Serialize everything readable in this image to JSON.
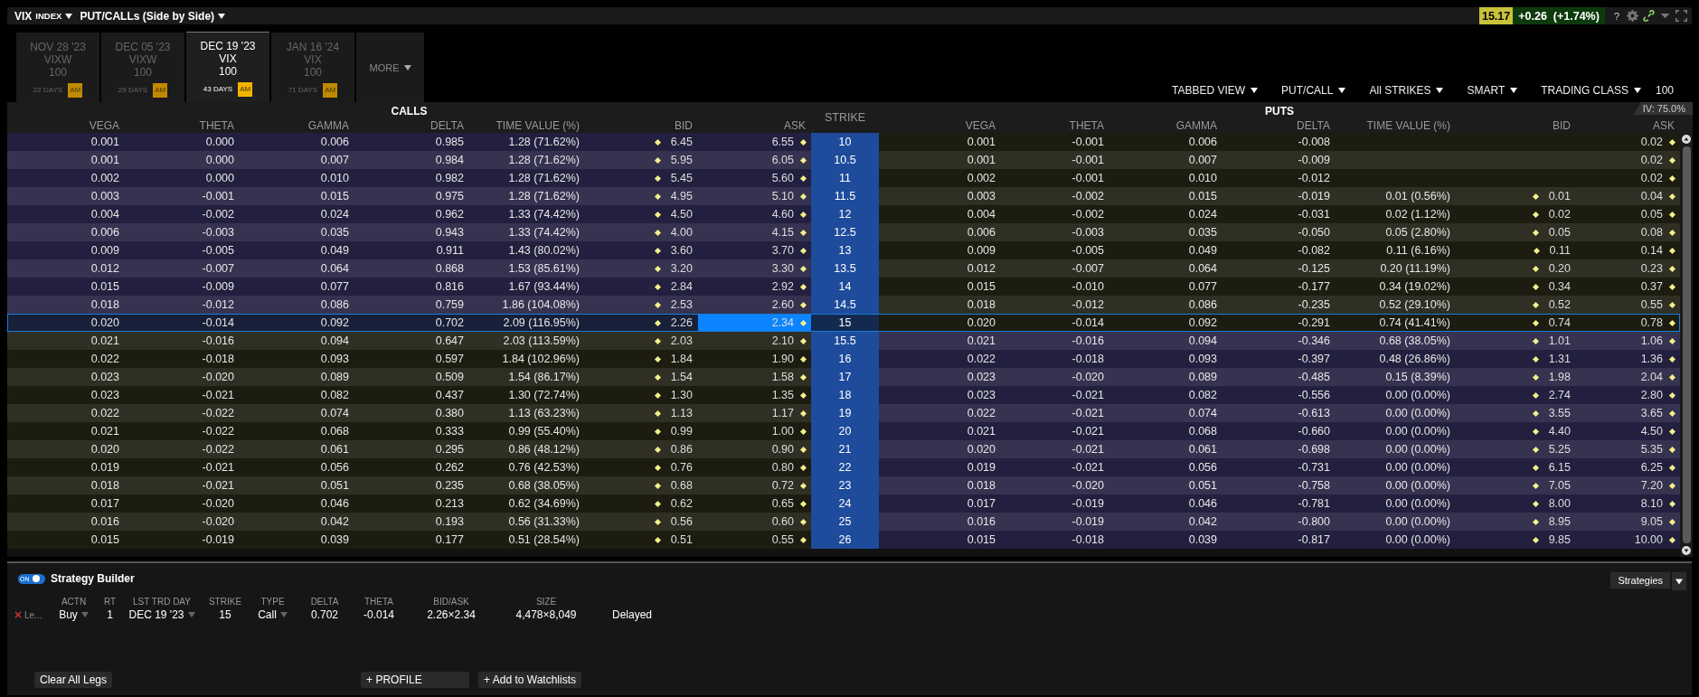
{
  "header": {
    "symbol": "VIX",
    "symbol_type": "INDEX",
    "view": "PUT/CALLs (Side by Side)",
    "price": "15.17",
    "change": "+0.26  (+1.74%)",
    "help": "?"
  },
  "expiry_tabs": [
    {
      "date": "NOV 28 '23",
      "class": "VIXW",
      "multiplier": "100",
      "days": "22 DAYS",
      "session": "AM",
      "selected": false
    },
    {
      "date": "DEC 05 '23",
      "class": "VIXW",
      "multiplier": "100",
      "days": "29 DAYS",
      "session": "AM",
      "selected": false
    },
    {
      "date": "DEC 19 '23",
      "class": "VIX",
      "multiplier": "100",
      "days": "43 DAYS",
      "session": "AM",
      "selected": true
    },
    {
      "date": "JAN 16 '24",
      "class": "VIX",
      "multiplier": "100",
      "days": "71 DAYS",
      "session": "AM",
      "selected": false
    }
  ],
  "more_tab": {
    "label": "MORE"
  },
  "toolbar": [
    {
      "label": "TABBED VIEW"
    },
    {
      "label": "PUT/CALL"
    },
    {
      "label": "All STRIKES"
    },
    {
      "label": "SMART"
    },
    {
      "label": "TRADING CLASS"
    }
  ],
  "trading_class_value": "100",
  "chain": {
    "calls_title": "CALLS",
    "puts_title": "PUTS",
    "strike_header": "STRIKE",
    "iv": "IV: 75.0%",
    "call_columns": [
      "VEGA",
      "THETA",
      "GAMMA",
      "DELTA",
      "TIME VALUE (%)",
      "BID",
      "ASK"
    ],
    "put_columns": [
      "VEGA",
      "THETA",
      "GAMMA",
      "DELTA",
      "TIME VALUE (%)",
      "BID",
      "ASK"
    ],
    "rows": [
      {
        "strike": "10",
        "calls_itm": true,
        "selected": false,
        "calls": {
          "vega": "0.001",
          "theta": "0.000",
          "gamma": "0.006",
          "delta": "0.985",
          "time_value": "1.28 (71.62%)",
          "bid": "6.45",
          "ask": "6.55"
        },
        "puts": {
          "vega": "0.001",
          "theta": "-0.001",
          "gamma": "0.006",
          "delta": "-0.008",
          "ask": "0.02"
        }
      },
      {
        "strike": "10.5",
        "calls_itm": true,
        "selected": false,
        "calls": {
          "vega": "0.001",
          "theta": "0.000",
          "gamma": "0.007",
          "delta": "0.984",
          "time_value": "1.28 (71.62%)",
          "bid": "5.95",
          "ask": "6.05"
        },
        "puts": {
          "vega": "0.001",
          "theta": "-0.001",
          "gamma": "0.007",
          "delta": "-0.009",
          "ask": "0.02"
        }
      },
      {
        "strike": "11",
        "calls_itm": true,
        "selected": false,
        "calls": {
          "vega": "0.002",
          "theta": "0.000",
          "gamma": "0.010",
          "delta": "0.982",
          "time_value": "1.28 (71.62%)",
          "bid": "5.45",
          "ask": "5.60"
        },
        "puts": {
          "vega": "0.002",
          "theta": "-0.001",
          "gamma": "0.010",
          "delta": "-0.012",
          "ask": "0.02"
        }
      },
      {
        "strike": "11.5",
        "calls_itm": true,
        "selected": false,
        "calls": {
          "vega": "0.003",
          "theta": "-0.001",
          "gamma": "0.015",
          "delta": "0.975",
          "time_value": "1.28 (71.62%)",
          "bid": "4.95",
          "ask": "5.10"
        },
        "puts": {
          "vega": "0.003",
          "theta": "-0.002",
          "gamma": "0.015",
          "delta": "-0.019",
          "time_value": "0.01 (0.56%)",
          "bid": "0.01",
          "ask": "0.04"
        }
      },
      {
        "strike": "12",
        "calls_itm": true,
        "selected": false,
        "calls": {
          "vega": "0.004",
          "theta": "-0.002",
          "gamma": "0.024",
          "delta": "0.962",
          "time_value": "1.33 (74.42%)",
          "bid": "4.50",
          "ask": "4.60"
        },
        "puts": {
          "vega": "0.004",
          "theta": "-0.002",
          "gamma": "0.024",
          "delta": "-0.031",
          "time_value": "0.02 (1.12%)",
          "bid": "0.02",
          "ask": "0.05"
        }
      },
      {
        "strike": "12.5",
        "calls_itm": true,
        "selected": false,
        "calls": {
          "vega": "0.006",
          "theta": "-0.003",
          "gamma": "0.035",
          "delta": "0.943",
          "time_value": "1.33 (74.42%)",
          "bid": "4.00",
          "ask": "4.15"
        },
        "puts": {
          "vega": "0.006",
          "theta": "-0.003",
          "gamma": "0.035",
          "delta": "-0.050",
          "time_value": "0.05 (2.80%)",
          "bid": "0.05",
          "ask": "0.08"
        }
      },
      {
        "strike": "13",
        "calls_itm": true,
        "selected": false,
        "calls": {
          "vega": "0.009",
          "theta": "-0.005",
          "gamma": "0.049",
          "delta": "0.911",
          "time_value": "1.43 (80.02%)",
          "bid": "3.60",
          "ask": "3.70"
        },
        "puts": {
          "vega": "0.009",
          "theta": "-0.005",
          "gamma": "0.049",
          "delta": "-0.082",
          "time_value": "0.11 (6.16%)",
          "bid": "0.11",
          "ask": "0.14"
        }
      },
      {
        "strike": "13.5",
        "calls_itm": true,
        "selected": false,
        "calls": {
          "vega": "0.012",
          "theta": "-0.007",
          "gamma": "0.064",
          "delta": "0.868",
          "time_value": "1.53 (85.61%)",
          "bid": "3.20",
          "ask": "3.30"
        },
        "puts": {
          "vega": "0.012",
          "theta": "-0.007",
          "gamma": "0.064",
          "delta": "-0.125",
          "time_value": "0.20 (11.19%)",
          "bid": "0.20",
          "ask": "0.23"
        }
      },
      {
        "strike": "14",
        "calls_itm": true,
        "selected": false,
        "calls": {
          "vega": "0.015",
          "theta": "-0.009",
          "gamma": "0.077",
          "delta": "0.816",
          "time_value": "1.67 (93.44%)",
          "bid": "2.84",
          "ask": "2.92"
        },
        "puts": {
          "vega": "0.015",
          "theta": "-0.010",
          "gamma": "0.077",
          "delta": "-0.177",
          "time_value": "0.34 (19.02%)",
          "bid": "0.34",
          "ask": "0.37"
        }
      },
      {
        "strike": "14.5",
        "calls_itm": true,
        "selected": false,
        "calls": {
          "vega": "0.018",
          "theta": "-0.012",
          "gamma": "0.086",
          "delta": "0.759",
          "time_value": "1.86 (104.08%)",
          "bid": "2.53",
          "ask": "2.60"
        },
        "puts": {
          "vega": "0.018",
          "theta": "-0.012",
          "gamma": "0.086",
          "delta": "-0.235",
          "time_value": "0.52 (29.10%)",
          "bid": "0.52",
          "ask": "0.55"
        }
      },
      {
        "strike": "15",
        "calls_itm": true,
        "selected": true,
        "calls": {
          "vega": "0.020",
          "theta": "-0.014",
          "gamma": "0.092",
          "delta": "0.702",
          "time_value": "2.09 (116.95%)",
          "bid": "2.26",
          "ask": "2.34"
        },
        "puts": {
          "vega": "0.020",
          "theta": "-0.014",
          "gamma": "0.092",
          "delta": "-0.291",
          "time_value": "0.74 (41.41%)",
          "bid": "0.74",
          "ask": "0.78"
        }
      },
      {
        "strike": "15.5",
        "calls_itm": false,
        "selected": false,
        "calls": {
          "vega": "0.021",
          "theta": "-0.016",
          "gamma": "0.094",
          "delta": "0.647",
          "time_value": "2.03 (113.59%)",
          "bid": "2.03",
          "ask": "2.10"
        },
        "puts": {
          "vega": "0.021",
          "theta": "-0.016",
          "gamma": "0.094",
          "delta": "-0.346",
          "time_value": "0.68 (38.05%)",
          "bid": "1.01",
          "ask": "1.06"
        }
      },
      {
        "strike": "16",
        "calls_itm": false,
        "selected": false,
        "calls": {
          "vega": "0.022",
          "theta": "-0.018",
          "gamma": "0.093",
          "delta": "0.597",
          "time_value": "1.84 (102.96%)",
          "bid": "1.84",
          "ask": "1.90"
        },
        "puts": {
          "vega": "0.022",
          "theta": "-0.018",
          "gamma": "0.093",
          "delta": "-0.397",
          "time_value": "0.48 (26.86%)",
          "bid": "1.31",
          "ask": "1.36"
        }
      },
      {
        "strike": "17",
        "calls_itm": false,
        "selected": false,
        "calls": {
          "vega": "0.023",
          "theta": "-0.020",
          "gamma": "0.089",
          "delta": "0.509",
          "time_value": "1.54 (86.17%)",
          "bid": "1.54",
          "ask": "1.58"
        },
        "puts": {
          "vega": "0.023",
          "theta": "-0.020",
          "gamma": "0.089",
          "delta": "-0.485",
          "time_value": "0.15 (8.39%)",
          "bid": "1.98",
          "ask": "2.04"
        }
      },
      {
        "strike": "18",
        "calls_itm": false,
        "selected": false,
        "calls": {
          "vega": "0.023",
          "theta": "-0.021",
          "gamma": "0.082",
          "delta": "0.437",
          "time_value": "1.30 (72.74%)",
          "bid": "1.30",
          "ask": "1.35"
        },
        "puts": {
          "vega": "0.023",
          "theta": "-0.021",
          "gamma": "0.082",
          "delta": "-0.556",
          "time_value": "0.00 (0.00%)",
          "bid": "2.74",
          "ask": "2.80"
        }
      },
      {
        "strike": "19",
        "calls_itm": false,
        "selected": false,
        "calls": {
          "vega": "0.022",
          "theta": "-0.022",
          "gamma": "0.074",
          "delta": "0.380",
          "time_value": "1.13 (63.23%)",
          "bid": "1.13",
          "ask": "1.17"
        },
        "puts": {
          "vega": "0.022",
          "theta": "-0.021",
          "gamma": "0.074",
          "delta": "-0.613",
          "time_value": "0.00 (0.00%)",
          "bid": "3.55",
          "ask": "3.65"
        }
      },
      {
        "strike": "20",
        "calls_itm": false,
        "selected": false,
        "calls": {
          "vega": "0.021",
          "theta": "-0.022",
          "gamma": "0.068",
          "delta": "0.333",
          "time_value": "0.99 (55.40%)",
          "bid": "0.99",
          "ask": "1.00"
        },
        "puts": {
          "vega": "0.021",
          "theta": "-0.021",
          "gamma": "0.068",
          "delta": "-0.660",
          "time_value": "0.00 (0.00%)",
          "bid": "4.40",
          "ask": "4.50"
        }
      },
      {
        "strike": "21",
        "calls_itm": false,
        "selected": false,
        "calls": {
          "vega": "0.020",
          "theta": "-0.022",
          "gamma": "0.061",
          "delta": "0.295",
          "time_value": "0.86 (48.12%)",
          "bid": "0.86",
          "ask": "0.90"
        },
        "puts": {
          "vega": "0.020",
          "theta": "-0.021",
          "gamma": "0.061",
          "delta": "-0.698",
          "time_value": "0.00 (0.00%)",
          "bid": "5.25",
          "ask": "5.35"
        }
      },
      {
        "strike": "22",
        "calls_itm": false,
        "selected": false,
        "calls": {
          "vega": "0.019",
          "theta": "-0.021",
          "gamma": "0.056",
          "delta": "0.262",
          "time_value": "0.76 (42.53%)",
          "bid": "0.76",
          "ask": "0.80"
        },
        "puts": {
          "vega": "0.019",
          "theta": "-0.021",
          "gamma": "0.056",
          "delta": "-0.731",
          "time_value": "0.00 (0.00%)",
          "bid": "6.15",
          "ask": "6.25"
        }
      },
      {
        "strike": "23",
        "calls_itm": false,
        "selected": false,
        "calls": {
          "vega": "0.018",
          "theta": "-0.021",
          "gamma": "0.051",
          "delta": "0.235",
          "time_value": "0.68 (38.05%)",
          "bid": "0.68",
          "ask": "0.72"
        },
        "puts": {
          "vega": "0.018",
          "theta": "-0.020",
          "gamma": "0.051",
          "delta": "-0.758",
          "time_value": "0.00 (0.00%)",
          "bid": "7.05",
          "ask": "7.20"
        }
      },
      {
        "strike": "24",
        "calls_itm": false,
        "selected": false,
        "calls": {
          "vega": "0.017",
          "theta": "-0.020",
          "gamma": "0.046",
          "delta": "0.213",
          "time_value": "0.62 (34.69%)",
          "bid": "0.62",
          "ask": "0.65"
        },
        "puts": {
          "vega": "0.017",
          "theta": "-0.019",
          "gamma": "0.046",
          "delta": "-0.781",
          "time_value": "0.00 (0.00%)",
          "bid": "8.00",
          "ask": "8.10"
        }
      },
      {
        "strike": "25",
        "calls_itm": false,
        "selected": false,
        "calls": {
          "vega": "0.016",
          "theta": "-0.020",
          "gamma": "0.042",
          "delta": "0.193",
          "time_value": "0.56 (31.33%)",
          "bid": "0.56",
          "ask": "0.60"
        },
        "puts": {
          "vega": "0.016",
          "theta": "-0.019",
          "gamma": "0.042",
          "delta": "-0.800",
          "time_value": "0.00 (0.00%)",
          "bid": "8.95",
          "ask": "9.05"
        }
      },
      {
        "strike": "26",
        "calls_itm": false,
        "selected": false,
        "calls": {
          "vega": "0.015",
          "theta": "-0.019",
          "gamma": "0.039",
          "delta": "0.177",
          "time_value": "0.51 (28.54%)",
          "bid": "0.51",
          "ask": "0.55"
        },
        "puts": {
          "vega": "0.015",
          "theta": "-0.018",
          "gamma": "0.039",
          "delta": "-0.817",
          "time_value": "0.00 (0.00%)",
          "bid": "9.85",
          "ask": "10.00"
        }
      }
    ]
  },
  "strategy_builder": {
    "on": true,
    "toggle_label": "ON",
    "title": "Strategy Builder",
    "strategies_button": "Strategies",
    "columns": [
      "ACTN",
      "RT",
      "LST TRD DAY",
      "STRIKE",
      "TYPE",
      "DELTA",
      "THETA",
      "BID/ASK",
      "SIZE"
    ],
    "leg": {
      "label": "Le...",
      "values": [
        {
          "text": "Buy",
          "dropdown": true
        },
        {
          "text": "1",
          "dropdown": false
        },
        {
          "text": "DEC 19 '23",
          "dropdown": true
        },
        {
          "text": "15",
          "dropdown": false
        },
        {
          "text": "Call",
          "dropdown": true
        },
        {
          "text": "0.702",
          "dropdown": false
        },
        {
          "text": "-0.014",
          "dropdown": false
        },
        {
          "text": "2.26×2.34",
          "dropdown": false
        },
        {
          "text": "4,478×8,049",
          "dropdown": false
        }
      ],
      "status": "Delayed"
    },
    "buttons": [
      "Clear All Legs",
      "+ PROFILE",
      "+ Add to Watchlists"
    ]
  }
}
